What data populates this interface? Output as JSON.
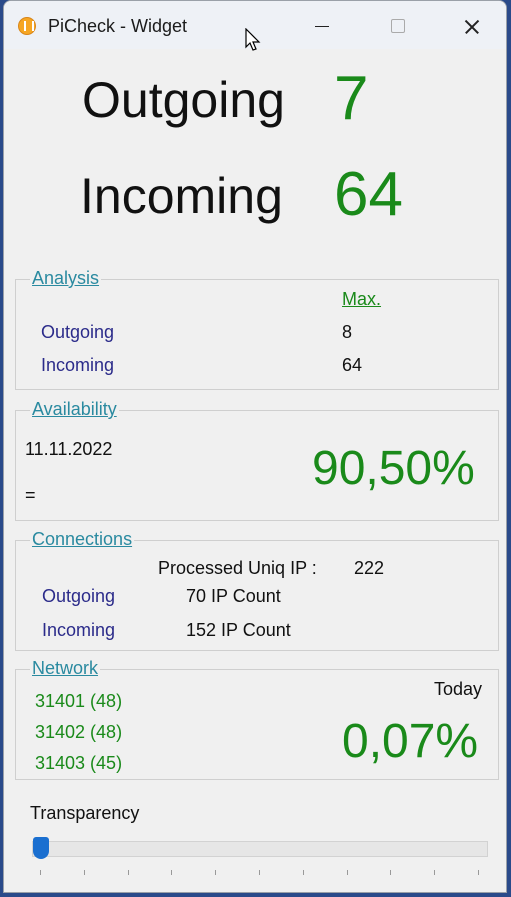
{
  "window": {
    "title": "PiCheck - Widget"
  },
  "summary": {
    "outgoing_label": "Outgoing",
    "outgoing_value": "7",
    "incoming_label": "Incoming",
    "incoming_value": "64"
  },
  "analysis": {
    "title": "Analysis",
    "max_header": "Max.",
    "outgoing_label": "Outgoing",
    "outgoing_max": "8",
    "incoming_label": "Incoming",
    "incoming_max": "64"
  },
  "availability": {
    "title": "Availability",
    "date": "11.11.2022",
    "equals": "=",
    "percent": "90,50%"
  },
  "connections": {
    "title": "Connections",
    "processed_label": "Processed Uniq IP :",
    "processed_value": "222",
    "outgoing_label": "Outgoing",
    "outgoing_count": "70 IP Count",
    "incoming_label": "Incoming",
    "incoming_count": "152 IP Count"
  },
  "network": {
    "title": "Network",
    "today_label": "Today",
    "percent": "0,07%",
    "ports": [
      "31401 (48)",
      "31402 (48)",
      "31403 (45)"
    ]
  },
  "transparency": {
    "label": "Transparency",
    "value_fraction": 0.0,
    "tick_count": 11
  },
  "colors": {
    "accent_green": "#1a8a1a",
    "label_blue": "#2b2b8a",
    "group_title": "#2a8aa0",
    "slider": "#1a6fd0"
  }
}
